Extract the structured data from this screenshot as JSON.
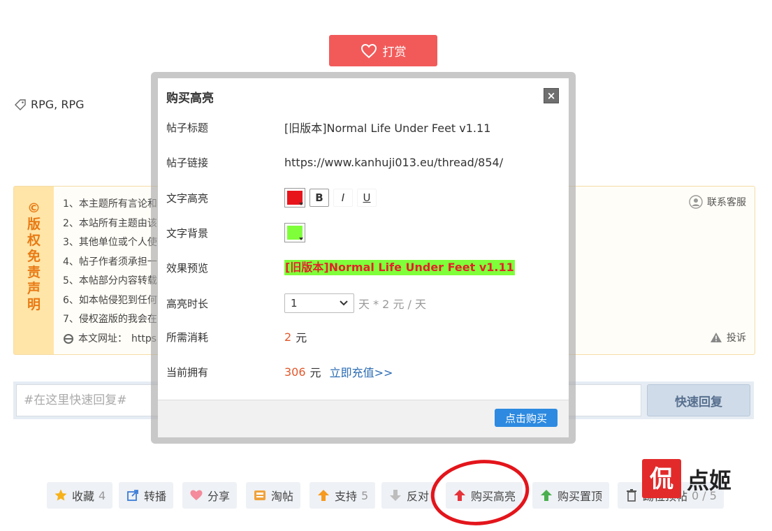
{
  "reward": {
    "label": "打赏"
  },
  "tags": {
    "text": "RPG, RPG"
  },
  "copyright": {
    "side_title": [
      "©",
      "版",
      "权",
      "免",
      "责",
      "声",
      "明"
    ],
    "lines": [
      "1、本主题所有言论和",
      "2、本站所有主题由该",
      "3、其他单位或个人使",
      "4、帖子作者须承担一",
      "5、本帖部分内容转载",
      "6、如本帖侵犯到任何",
      "7、侵权盗版的我会在"
    ],
    "url_label": "本文网址：",
    "url_value": "https",
    "contact": "联系客服",
    "complain": "投诉"
  },
  "reply": {
    "placeholder": "#在这里快速回复#",
    "button": "快速回复"
  },
  "actions": {
    "favorite": {
      "label": "收藏",
      "count": "4"
    },
    "forward": {
      "label": "转播"
    },
    "share": {
      "label": "分享"
    },
    "taotie": {
      "label": "淘帖"
    },
    "support": {
      "label": "支持",
      "count": "5"
    },
    "oppose": {
      "label": "反对"
    },
    "buy_highlight": {
      "label": "购买高亮"
    },
    "buy_top": {
      "label": "购买置顶"
    },
    "bump": {
      "label": "踢位顶帖",
      "count": "0 / 5"
    }
  },
  "modal": {
    "title": "购买高亮",
    "close": "×",
    "post_title_label": "帖子标题",
    "post_title_value": "[旧版本]Normal Life Under Feet v1.11",
    "post_link_label": "帖子链接",
    "post_link_value": "https://www.kanhuji013.eu/thread/854/",
    "text_highlight_label": "文字高亮",
    "text_color": "#e8141c",
    "bold": "B",
    "italic": "I",
    "underline": "U",
    "text_bg_label": "文字背景",
    "bg_color": "#7fff3a",
    "preview_label": "效果预览",
    "preview_value": "[旧版本]Normal Life Under Feet v1.11",
    "duration_label": "高亮时长",
    "duration_value": "1",
    "duration_unit": "天 * 2 元 / 天",
    "cost_label": "所需消耗",
    "cost_value": "2",
    "cost_unit": "元",
    "balance_label": "当前拥有",
    "balance_value": "306",
    "balance_unit": "元",
    "recharge": "立即充值>>",
    "buy_button": "点击购买"
  },
  "watermark": {
    "text": "侃点·姬"
  }
}
